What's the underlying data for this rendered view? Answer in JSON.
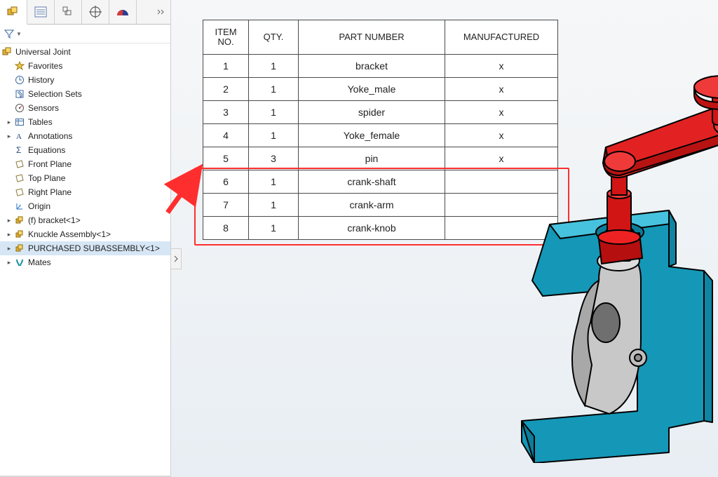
{
  "tree": {
    "root": "Universal Joint",
    "items": [
      {
        "label": "Favorites"
      },
      {
        "label": "History"
      },
      {
        "label": "Selection Sets"
      },
      {
        "label": "Sensors"
      },
      {
        "label": "Tables",
        "expandable": true
      },
      {
        "label": "Annotations",
        "expandable": true
      },
      {
        "label": "Equations"
      },
      {
        "label": "Front Plane"
      },
      {
        "label": "Top Plane"
      },
      {
        "label": "Right Plane"
      },
      {
        "label": "Origin"
      },
      {
        "label": "(f) bracket<1>",
        "expandable": true,
        "part": true
      },
      {
        "label": "Knuckle Assembly<1>",
        "expandable": true,
        "part": true
      },
      {
        "label": "PURCHASED SUBASSEMBLY<1>",
        "expandable": true,
        "part": true,
        "highlight": true
      },
      {
        "label": "Mates",
        "expandable": true,
        "mates": true
      }
    ]
  },
  "bom": {
    "headers": {
      "item": "ITEM NO.",
      "qty": "QTY.",
      "pn": "PART NUMBER",
      "mfg": "MANUFACTURED"
    },
    "rows": [
      {
        "n": "1",
        "q": "1",
        "pn": "bracket",
        "m": "x"
      },
      {
        "n": "2",
        "q": "1",
        "pn": "Yoke_male",
        "m": "x"
      },
      {
        "n": "3",
        "q": "1",
        "pn": "spider",
        "m": "x"
      },
      {
        "n": "4",
        "q": "1",
        "pn": "Yoke_female",
        "m": "x"
      },
      {
        "n": "5",
        "q": "3",
        "pn": "pin",
        "m": "x"
      },
      {
        "n": "6",
        "q": "1",
        "pn": "crank-shaft",
        "m": ""
      },
      {
        "n": "7",
        "q": "1",
        "pn": "crank-arm",
        "m": ""
      },
      {
        "n": "8",
        "q": "1",
        "pn": "crank-knob",
        "m": ""
      }
    ],
    "highlight_from_row": 5
  },
  "chart_data": {
    "type": "table",
    "title": "Bill of Materials",
    "columns": [
      "ITEM NO.",
      "QTY.",
      "PART NUMBER",
      "MANUFACTURED"
    ],
    "rows": [
      [
        1,
        1,
        "bracket",
        "x"
      ],
      [
        2,
        1,
        "Yoke_male",
        "x"
      ],
      [
        3,
        1,
        "spider",
        "x"
      ],
      [
        4,
        1,
        "Yoke_female",
        "x"
      ],
      [
        5,
        3,
        "pin",
        "x"
      ],
      [
        6,
        1,
        "crank-shaft",
        ""
      ],
      [
        7,
        1,
        "crank-arm",
        ""
      ],
      [
        8,
        1,
        "crank-knob",
        ""
      ]
    ]
  }
}
